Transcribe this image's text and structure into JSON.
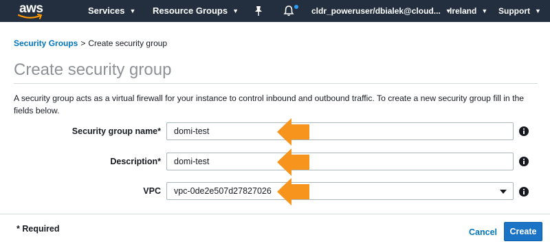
{
  "topbar": {
    "logo_text": "aws",
    "services_label": "Services",
    "resource_groups_label": "Resource Groups",
    "account_label": "cldr_poweruser/dbialek@cloud...",
    "region_label": "Ireland",
    "support_label": "Support",
    "notification_dot_color": "#2e9cf4"
  },
  "breadcrumb": {
    "parent": "Security Groups",
    "separator": ">",
    "current": "Create security group"
  },
  "page": {
    "title": "Create security group",
    "description": "A security group acts as a virtual firewall for your instance to control inbound and outbound traffic. To create a new security group fill in the fields below."
  },
  "form": {
    "name_label": "Security group name*",
    "name_value": "domi-test",
    "description_label": "Description*",
    "description_value": "domi-test",
    "vpc_label": "VPC",
    "vpc_value": "vpc-0de2e507d27827026"
  },
  "footer": {
    "required_note": "* Required",
    "cancel_label": "Cancel",
    "create_label": "Create"
  },
  "colors": {
    "nav_bg": "#232f3e",
    "link": "#0073bb",
    "primary_button": "#1a73c4",
    "annotation_arrow": "#f7941d"
  },
  "icons": [
    "aws-smile-icon",
    "chevron-down-icon",
    "pin-icon",
    "bell-icon",
    "info-icon",
    "annotation-arrow-icon"
  ]
}
